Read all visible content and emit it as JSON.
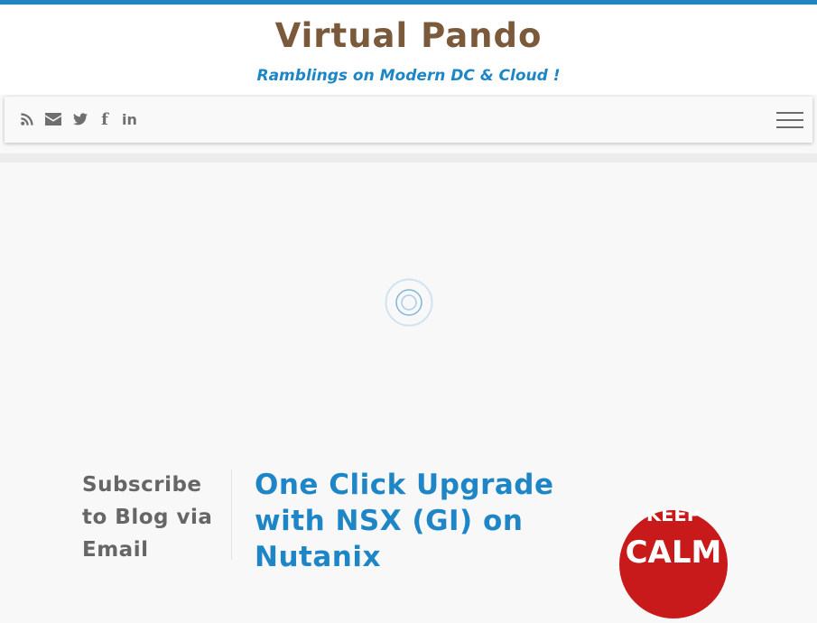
{
  "site": {
    "title": "Virtual Pando",
    "tagline": "Ramblings on Modern DC & Cloud !"
  },
  "colors": {
    "accent": "#1e86c6",
    "title_brown": "#7b5a3b",
    "icon_gray": "#6f6f6f",
    "badge_red": "#c81a1a"
  },
  "social": {
    "icons": [
      "rss-icon",
      "envelope-icon",
      "twitter-icon",
      "facebook-icon",
      "linkedin-icon"
    ],
    "facebook_glyph": "f",
    "linkedin_glyph": "in"
  },
  "sidebar": {
    "widget_title": "Subscribe to Blog via Email"
  },
  "post": {
    "title": "One Click Upgrade with NSX (GI) on Nutanix"
  },
  "badge": {
    "line1": "KEEP",
    "line2": "CALM"
  }
}
